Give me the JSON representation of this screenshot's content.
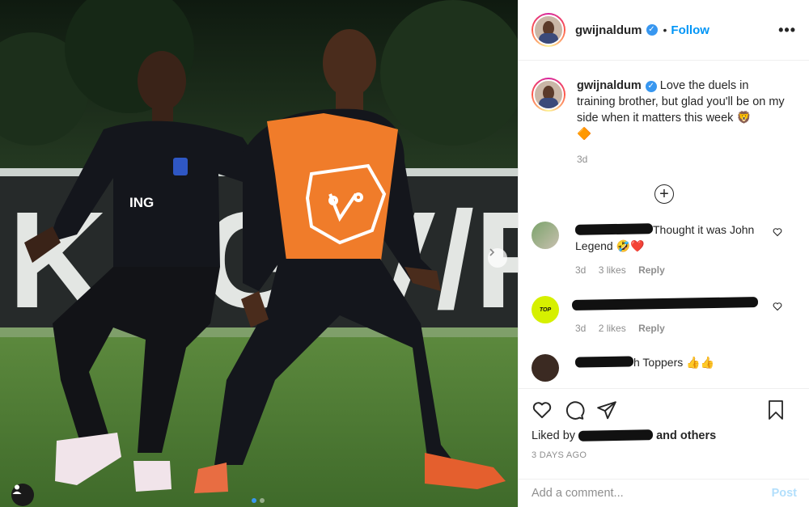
{
  "post": {
    "username": "gwijnaldum",
    "follow_label": "Follow",
    "bullet": "•",
    "more_icon": "•••"
  },
  "photo": {
    "shirt_lettering": "ING",
    "board_letters": "KEG V/F"
  },
  "caption": {
    "username": "gwijnaldum",
    "text": "Love the duels in training brother, but glad you'll be on my side when it matters this week 🦁",
    "emoji_extra": "🔶",
    "time": "3d"
  },
  "comments": [
    {
      "text_suffix": "Thought it was John Legend",
      "emojis": "🤣❤️",
      "time": "3d",
      "likes": "3 likes",
      "reply": "Reply"
    },
    {
      "text_suffix": "",
      "emojis": "",
      "time": "3d",
      "likes": "2 likes",
      "reply": "Reply"
    },
    {
      "text_suffix": "h Toppers",
      "emojis": "👍👍"
    }
  ],
  "actions": {
    "liked_prefix": "Liked by",
    "liked_suffix": "and others",
    "date": "3 DAYS AGO"
  },
  "composer": {
    "placeholder": "Add a comment...",
    "post_label": "Post"
  },
  "colors": {
    "accent": "#0095f6",
    "verified": "#3897f0",
    "bib_orange": "#f07c2a",
    "grass": "#4f7a34"
  }
}
